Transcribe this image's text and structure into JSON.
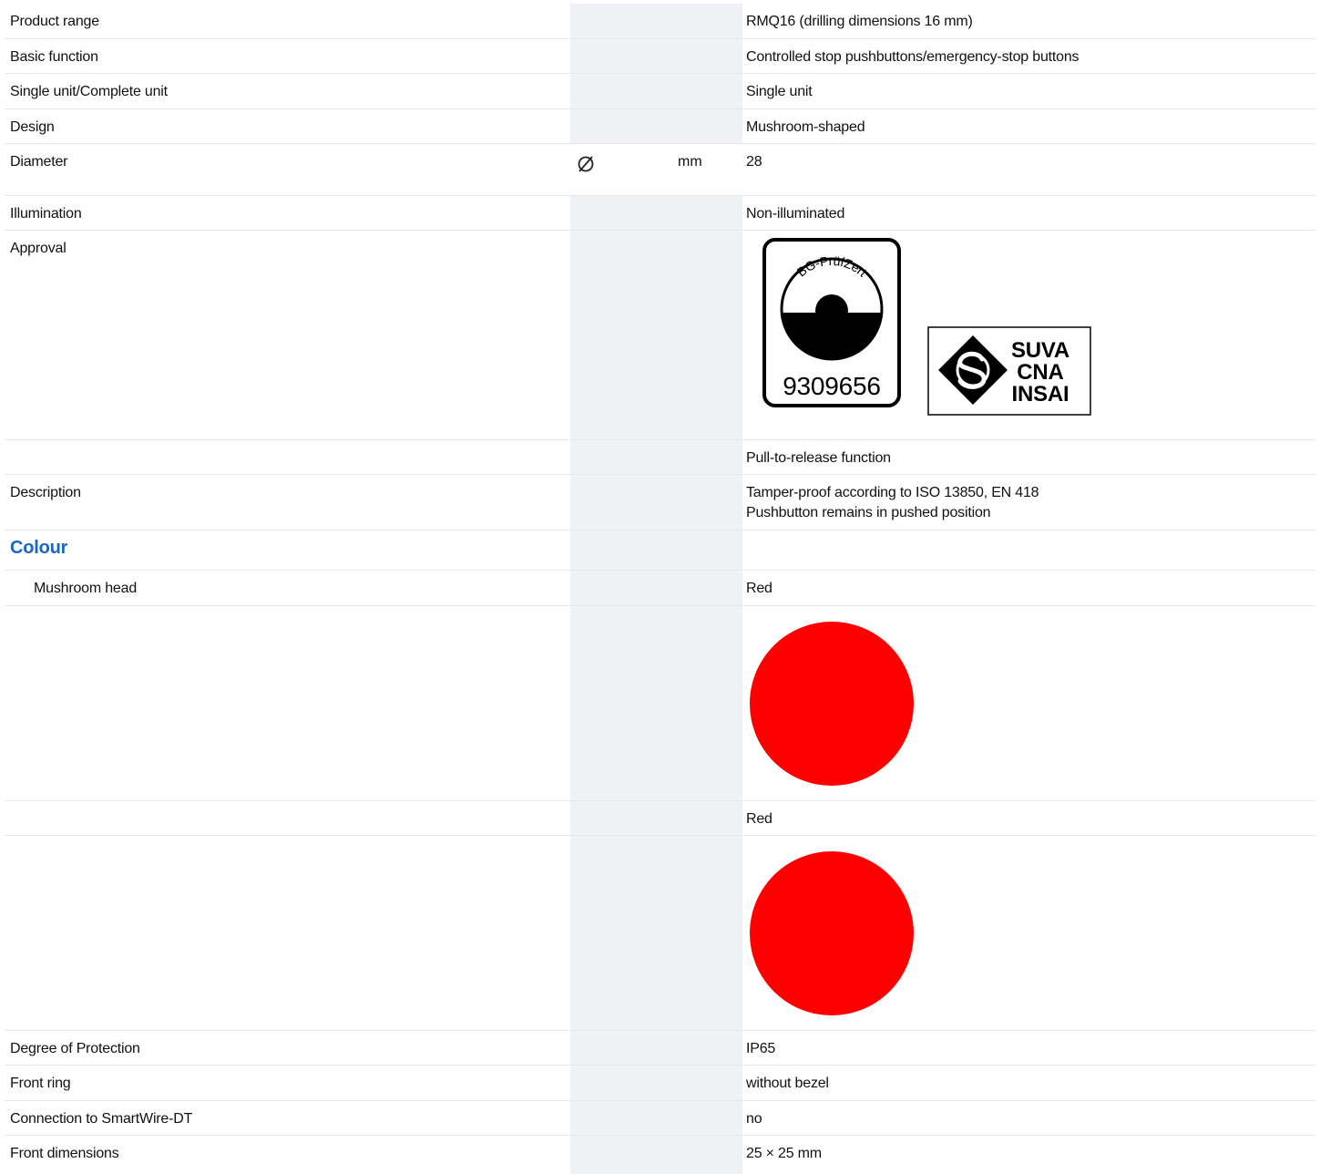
{
  "rows": [
    {
      "label": "Product range",
      "value": "RMQ16 (drilling dimensions 16 mm)"
    },
    {
      "label": "Basic function",
      "value": "Controlled stop pushbuttons/emergency-stop buttons"
    },
    {
      "label": "Single unit/Complete unit",
      "value": "Single unit"
    },
    {
      "label": "Design",
      "value": "Mushroom-shaped"
    },
    {
      "label": "Diameter",
      "symbol_icon": "diameter-icon",
      "unit": "mm",
      "value": "28"
    },
    {
      "label": "Illumination",
      "value": "Non-illuminated"
    },
    {
      "label": "Approval",
      "logos": [
        "BG-PrüfZert 9309656",
        "SUVA CNA INSAI"
      ]
    },
    {
      "label": "",
      "value": "Pull-to-release function"
    },
    {
      "label": "Description",
      "value_line1": "Tamper-proof according to ISO 13850, EN 418",
      "value_line2": "Pushbutton remains in pushed position"
    }
  ],
  "approval": {
    "bg_logo_text": "BG-PrüfZert",
    "bg_logo_number": "9309656",
    "suva_line1": "SUVA",
    "suva_line2": "CNA",
    "suva_line3": "INSAI"
  },
  "colour_section": {
    "title": "Colour",
    "mushroom_head_label": "Mushroom head",
    "mushroom_head_value": "Red",
    "swatch_color": "#ff0000",
    "second_value": "Red"
  },
  "rows_after": [
    {
      "label": "Degree of Protection",
      "value": "IP65"
    },
    {
      "label": "Front ring",
      "value": "without bezel"
    },
    {
      "label": "Connection to SmartWire-DT",
      "value": "no"
    },
    {
      "label": "Front dimensions",
      "value": "25 × 25 mm"
    }
  ],
  "colors": {
    "section_title": "#1a66c4",
    "column_shade": "#f0f1f5",
    "row_divider": "#e6e8ec"
  }
}
